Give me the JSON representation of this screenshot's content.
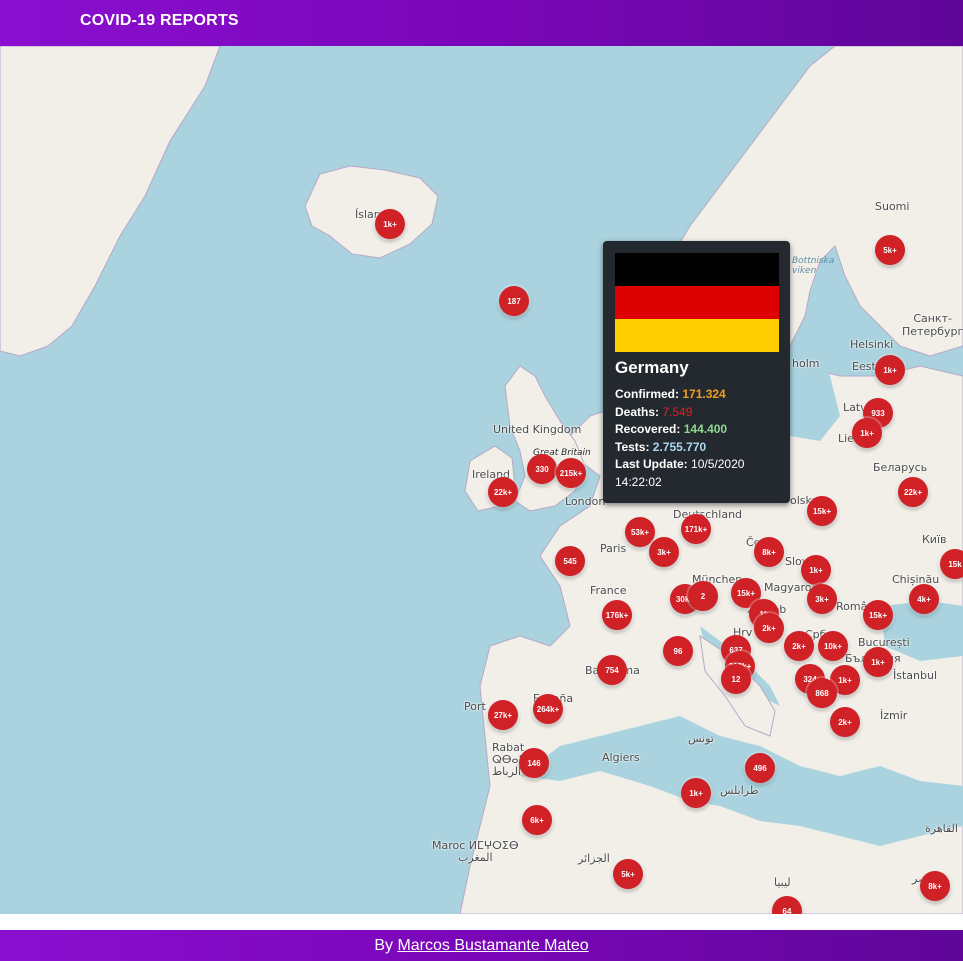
{
  "header": {
    "title": "COVID-19 REPORTS"
  },
  "map": {
    "places": [
      {
        "id": "islandia",
        "text": "Ísland"
      },
      {
        "id": "suomi",
        "text": "Suomi"
      },
      {
        "id": "bottniska",
        "text": "Bottniska\nviken"
      },
      {
        "id": "helsinki",
        "text": "Helsinki"
      },
      {
        "id": "spb",
        "text": "Санкт-\nПетербург"
      },
      {
        "id": "stockholm",
        "text": "holm"
      },
      {
        "id": "eesti",
        "text": "Eesti"
      },
      {
        "id": "latvija",
        "text": "Latv"
      },
      {
        "id": "lie",
        "text": "Lie"
      },
      {
        "id": "belarus",
        "text": "Беларусь"
      },
      {
        "id": "kyiv",
        "text": "Київ"
      },
      {
        "id": "uk",
        "text": "United Kingdom"
      },
      {
        "id": "gb",
        "text": "Great Britain"
      },
      {
        "id": "ireland",
        "text": "Ireland"
      },
      {
        "id": "london",
        "text": "London"
      },
      {
        "id": "deutschland",
        "text": "Deutschland"
      },
      {
        "id": "polska",
        "text": "olska"
      },
      {
        "id": "paris",
        "text": "Paris"
      },
      {
        "id": "france",
        "text": "France"
      },
      {
        "id": "munchen",
        "text": "München"
      },
      {
        "id": "cesko",
        "text": "Če"
      },
      {
        "id": "slovensko",
        "text": "Slovens"
      },
      {
        "id": "magyar",
        "text": "Magyarorsz"
      },
      {
        "id": "zagreb",
        "text": "Zagreb"
      },
      {
        "id": "hrvatska",
        "text": "Hrv"
      },
      {
        "id": "romania",
        "text": "Români"
      },
      {
        "id": "chisinau",
        "text": "Chișinău"
      },
      {
        "id": "bucuresti",
        "text": "București"
      },
      {
        "id": "bulgaria",
        "text": "България"
      },
      {
        "id": "srb",
        "text": "Срб"
      },
      {
        "id": "istanbul",
        "text": "İstanbul"
      },
      {
        "id": "izmir",
        "text": "İzmir"
      },
      {
        "id": "portugal",
        "text": "Port"
      },
      {
        "id": "espana",
        "text": "España"
      },
      {
        "id": "barcelona",
        "text": "Barcelona"
      },
      {
        "id": "rabat",
        "text": "Rabat\nⵕⴱⴰⵟ\nالرباط"
      },
      {
        "id": "algiers",
        "text": "Algiers"
      },
      {
        "id": "tunis",
        "text": "تونس"
      },
      {
        "id": "tripoli",
        "text": "طرابلس"
      },
      {
        "id": "maroc",
        "text": "Maroc ⵍⵎⵖⵔⵉⴱ\nالمغرب"
      },
      {
        "id": "dzair",
        "text": "الجزائر"
      },
      {
        "id": "libya",
        "text": "ليبيا"
      },
      {
        "id": "cairo",
        "text": "القاهرة"
      },
      {
        "id": "misr",
        "text": "مصر"
      }
    ],
    "markers": [
      {
        "label": "1k+"
      },
      {
        "label": "187"
      },
      {
        "label": "5k+"
      },
      {
        "label": "1k+"
      },
      {
        "label": "933"
      },
      {
        "label": "1k+"
      },
      {
        "label": "22k+"
      },
      {
        "label": "330"
      },
      {
        "label": "215k+"
      },
      {
        "label": "22k+"
      },
      {
        "label": "15k+"
      },
      {
        "label": "53k+"
      },
      {
        "label": "171k+"
      },
      {
        "label": "3k+"
      },
      {
        "label": "8k+"
      },
      {
        "label": "545"
      },
      {
        "label": "1k+"
      },
      {
        "label": "15k"
      },
      {
        "label": "15k+"
      },
      {
        "label": "3k+"
      },
      {
        "label": "4k+"
      },
      {
        "label": "30k+"
      },
      {
        "label": "2"
      },
      {
        "label": "176k+"
      },
      {
        "label": "1k"
      },
      {
        "label": "2k+"
      },
      {
        "label": "15k+"
      },
      {
        "label": "2k+"
      },
      {
        "label": "10k+"
      },
      {
        "label": "1k+"
      },
      {
        "label": "96"
      },
      {
        "label": "637"
      },
      {
        "label": "218k+"
      },
      {
        "label": "754"
      },
      {
        "label": "12"
      },
      {
        "label": "324"
      },
      {
        "label": "1k+"
      },
      {
        "label": "868"
      },
      {
        "label": "27k+"
      },
      {
        "label": "264k+"
      },
      {
        "label": "2k+"
      },
      {
        "label": "146"
      },
      {
        "label": "496"
      },
      {
        "label": "1k+"
      },
      {
        "label": "6k+"
      },
      {
        "label": "5k+"
      },
      {
        "label": "8k+"
      },
      {
        "label": "64"
      }
    ]
  },
  "tooltip": {
    "flag_colors": [
      "#000000",
      "#dd0000",
      "#ffce00"
    ],
    "country": "Germany",
    "confirmed_label": "Confirmed:",
    "confirmed_value": "171.324",
    "confirmed_color": "#f0a020",
    "deaths_label": "Deaths:",
    "deaths_value": "7.549",
    "deaths_color": "#e02020",
    "recovered_label": "Recovered:",
    "recovered_value": "144.400",
    "recovered_color": "#8fd88f",
    "tests_label": "Tests:",
    "tests_value": "2.755.770",
    "tests_color": "#a8d8f0",
    "update_label": "Last Update:",
    "update_value": "10/5/2020",
    "update_time": "14:22:02"
  },
  "footer": {
    "prefix": "By",
    "author": "Marcos Bustamante Mateo"
  }
}
